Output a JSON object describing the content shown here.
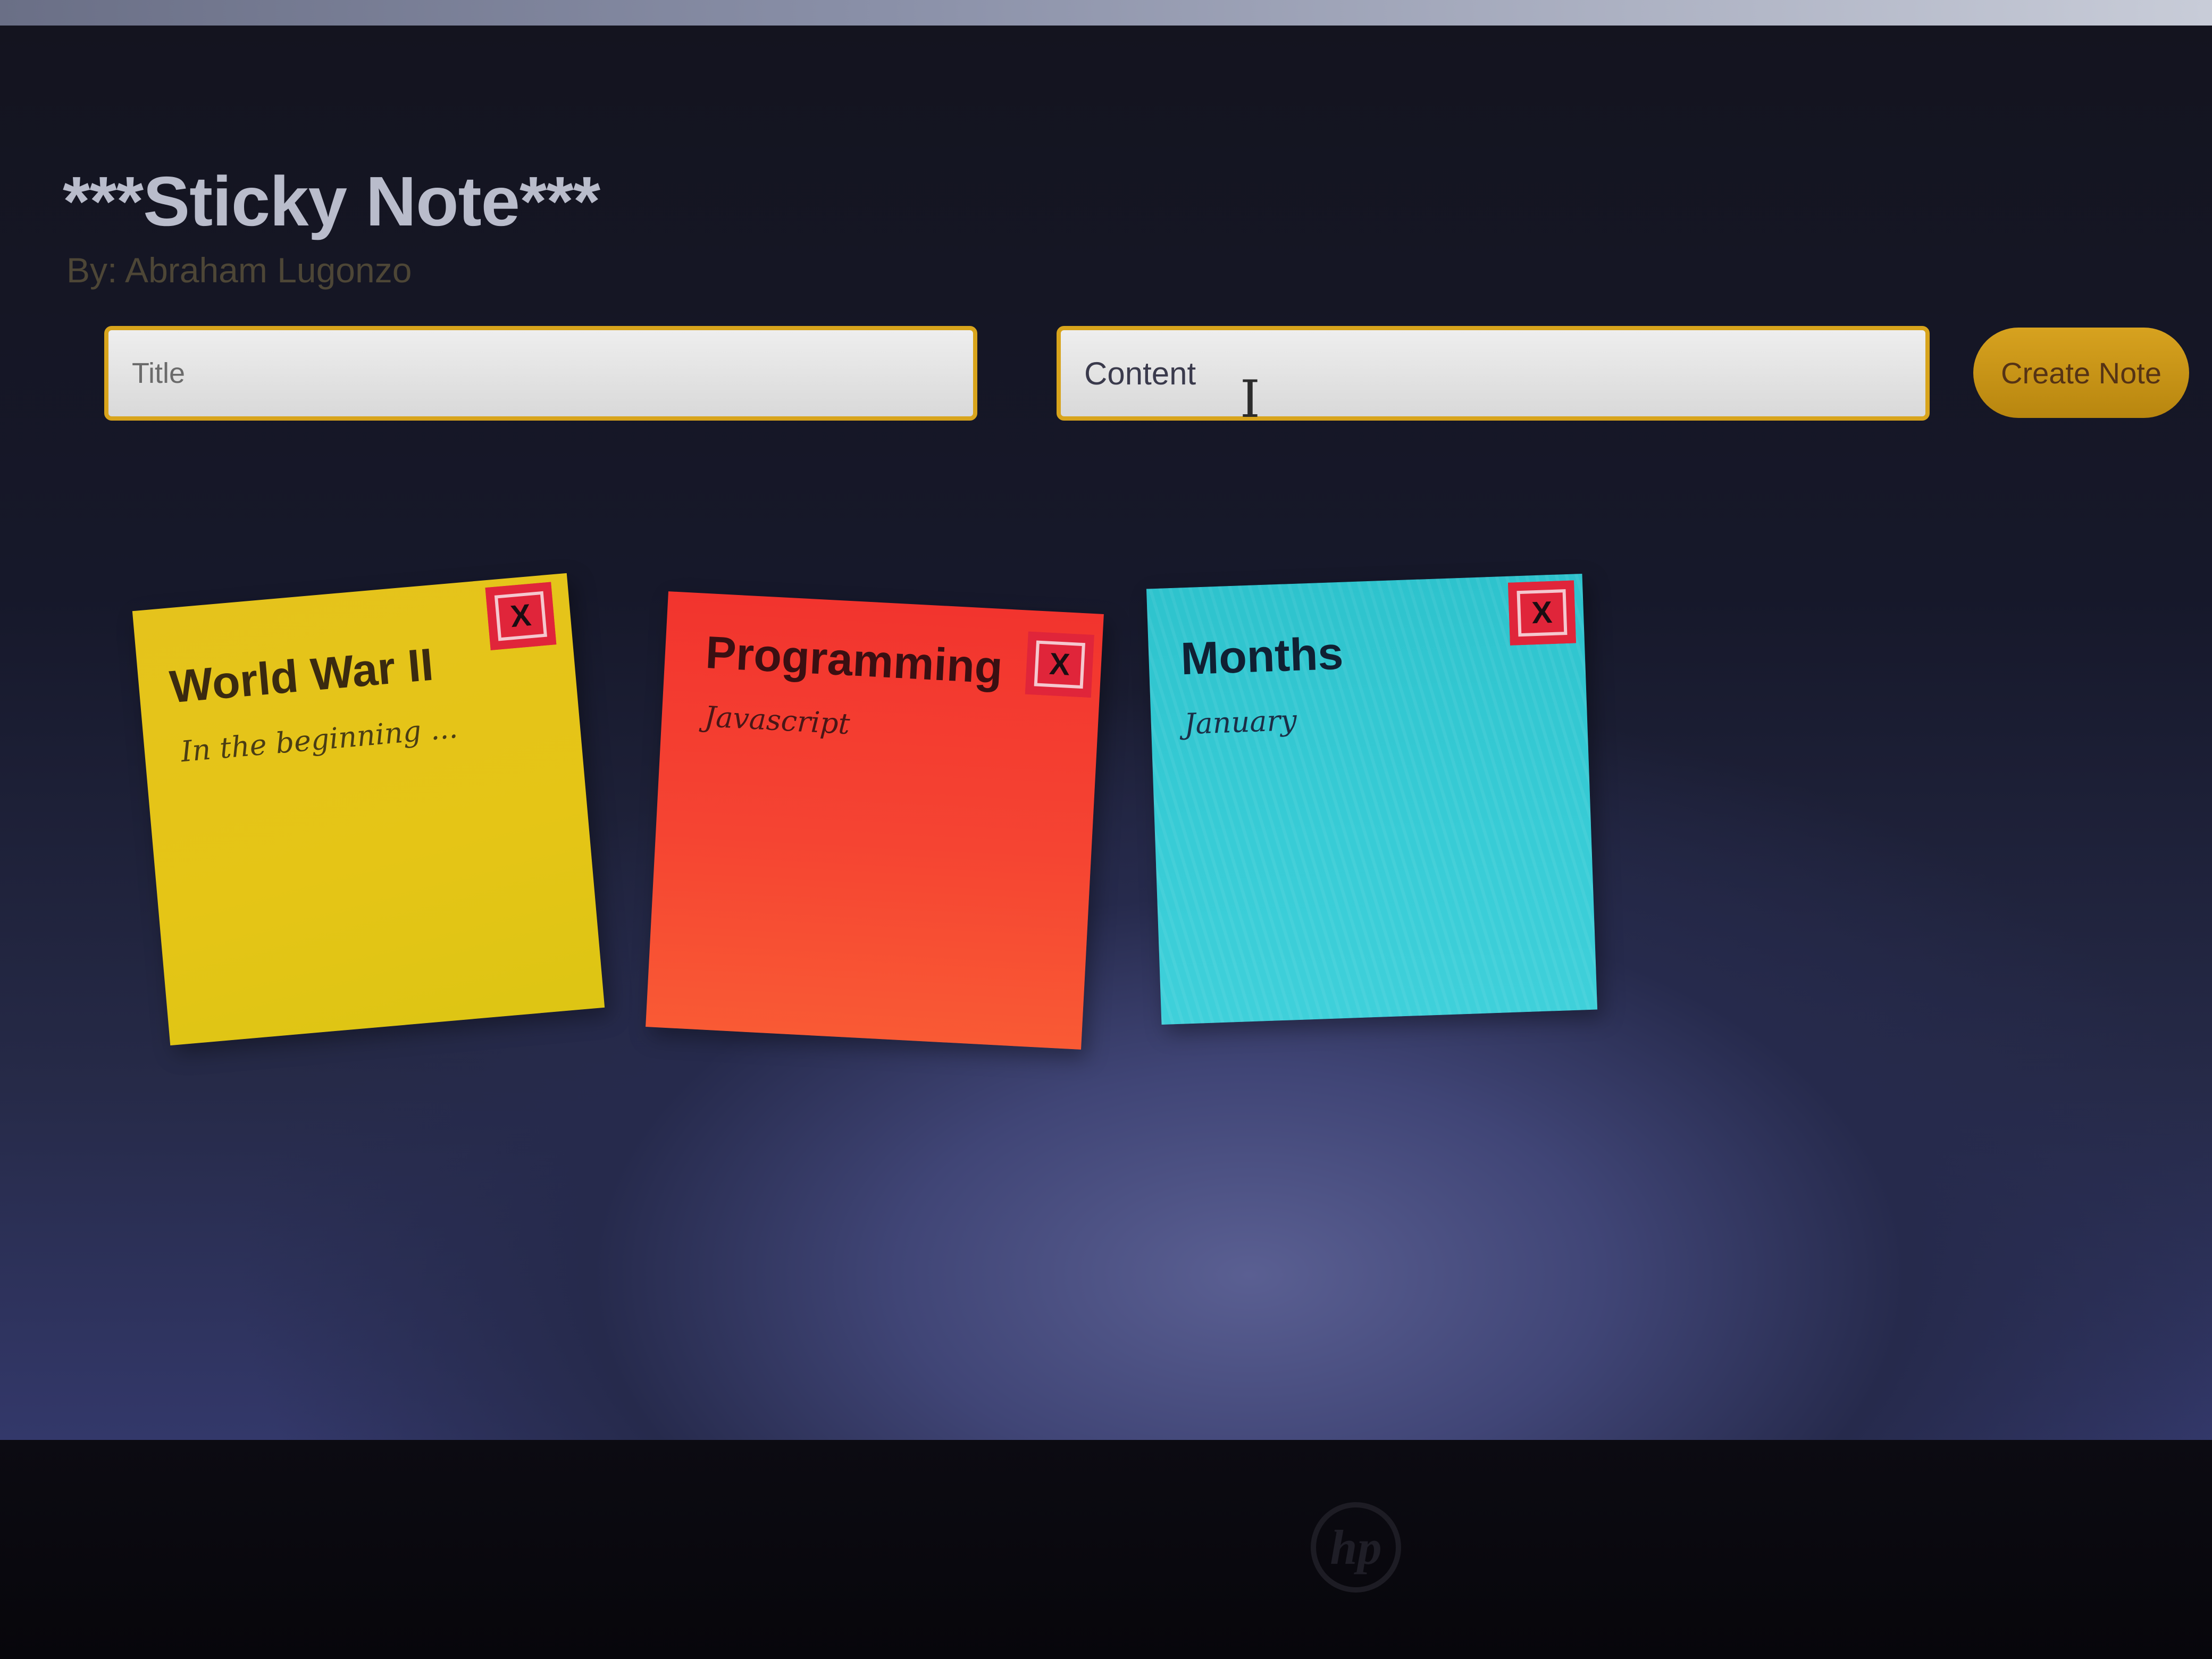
{
  "app": {
    "title": "***Sticky Note***",
    "author": "By: Abraham Lugonzo"
  },
  "form": {
    "title_placeholder": "Title",
    "content_placeholder": "Content",
    "create_label": "Create Note"
  },
  "notes": [
    {
      "title": "World War II",
      "content": "In the beginning ...",
      "color": "#e5c31c",
      "close_label": "X"
    },
    {
      "title": "Programming",
      "content": "Javascript",
      "color": "#f54432",
      "close_label": "X"
    },
    {
      "title": "Months",
      "content": "January",
      "color": "#38ccd6",
      "close_label": "X"
    }
  ],
  "colors": {
    "accent": "#d8a41c",
    "close_button": "#e0253a",
    "background": "#16182a"
  }
}
